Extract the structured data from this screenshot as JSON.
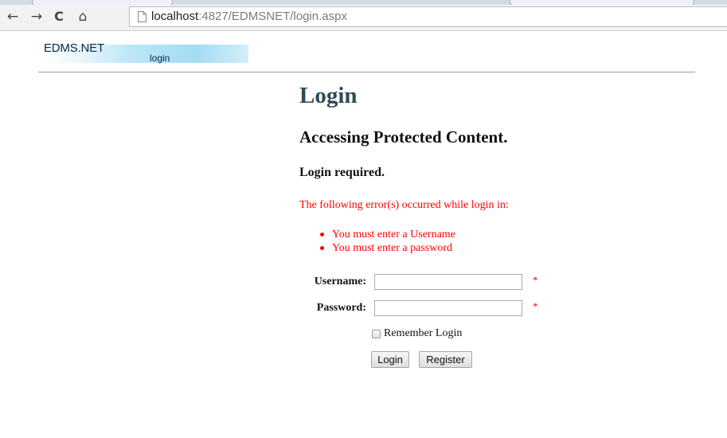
{
  "browser": {
    "back_icon": "←",
    "forward_icon": "→",
    "reload_icon": "C",
    "home_icon": "⌂",
    "url_host": "localhost",
    "url_rest": ":4827/EDMSNET/login.aspx"
  },
  "header": {
    "site_title": "EDMS.NET",
    "subtitle": "login"
  },
  "main": {
    "title": "Login",
    "subtitle": "Accessing Protected Content.",
    "required": "Login required.",
    "error_intro": "The following error(s) occurred while login in:",
    "errors": [
      "You must enter a Username",
      "You must enter a password"
    ]
  },
  "form": {
    "username_label": "Username:",
    "username_value": "",
    "password_label": "Password:",
    "password_value": "",
    "required_marker": "*",
    "remember_label": "Remember Login",
    "remember_checked": false,
    "login_button": "Login",
    "register_button": "Register"
  },
  "colors": {
    "error": "#ff0000",
    "title": "#2e4a59",
    "banner": "#a3dcf4"
  }
}
